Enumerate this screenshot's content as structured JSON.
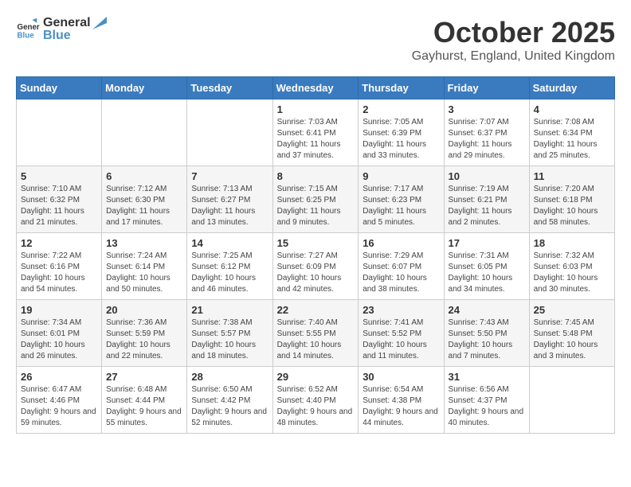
{
  "header": {
    "logo_general": "General",
    "logo_blue": "Blue",
    "month": "October 2025",
    "location": "Gayhurst, England, United Kingdom"
  },
  "days_of_week": [
    "Sunday",
    "Monday",
    "Tuesday",
    "Wednesday",
    "Thursday",
    "Friday",
    "Saturday"
  ],
  "weeks": [
    [
      {
        "day": "",
        "info": ""
      },
      {
        "day": "",
        "info": ""
      },
      {
        "day": "",
        "info": ""
      },
      {
        "day": "1",
        "info": "Sunrise: 7:03 AM\nSunset: 6:41 PM\nDaylight: 11 hours and 37 minutes."
      },
      {
        "day": "2",
        "info": "Sunrise: 7:05 AM\nSunset: 6:39 PM\nDaylight: 11 hours and 33 minutes."
      },
      {
        "day": "3",
        "info": "Sunrise: 7:07 AM\nSunset: 6:37 PM\nDaylight: 11 hours and 29 minutes."
      },
      {
        "day": "4",
        "info": "Sunrise: 7:08 AM\nSunset: 6:34 PM\nDaylight: 11 hours and 25 minutes."
      }
    ],
    [
      {
        "day": "5",
        "info": "Sunrise: 7:10 AM\nSunset: 6:32 PM\nDaylight: 11 hours and 21 minutes."
      },
      {
        "day": "6",
        "info": "Sunrise: 7:12 AM\nSunset: 6:30 PM\nDaylight: 11 hours and 17 minutes."
      },
      {
        "day": "7",
        "info": "Sunrise: 7:13 AM\nSunset: 6:27 PM\nDaylight: 11 hours and 13 minutes."
      },
      {
        "day": "8",
        "info": "Sunrise: 7:15 AM\nSunset: 6:25 PM\nDaylight: 11 hours and 9 minutes."
      },
      {
        "day": "9",
        "info": "Sunrise: 7:17 AM\nSunset: 6:23 PM\nDaylight: 11 hours and 5 minutes."
      },
      {
        "day": "10",
        "info": "Sunrise: 7:19 AM\nSunset: 6:21 PM\nDaylight: 11 hours and 2 minutes."
      },
      {
        "day": "11",
        "info": "Sunrise: 7:20 AM\nSunset: 6:18 PM\nDaylight: 10 hours and 58 minutes."
      }
    ],
    [
      {
        "day": "12",
        "info": "Sunrise: 7:22 AM\nSunset: 6:16 PM\nDaylight: 10 hours and 54 minutes."
      },
      {
        "day": "13",
        "info": "Sunrise: 7:24 AM\nSunset: 6:14 PM\nDaylight: 10 hours and 50 minutes."
      },
      {
        "day": "14",
        "info": "Sunrise: 7:25 AM\nSunset: 6:12 PM\nDaylight: 10 hours and 46 minutes."
      },
      {
        "day": "15",
        "info": "Sunrise: 7:27 AM\nSunset: 6:09 PM\nDaylight: 10 hours and 42 minutes."
      },
      {
        "day": "16",
        "info": "Sunrise: 7:29 AM\nSunset: 6:07 PM\nDaylight: 10 hours and 38 minutes."
      },
      {
        "day": "17",
        "info": "Sunrise: 7:31 AM\nSunset: 6:05 PM\nDaylight: 10 hours and 34 minutes."
      },
      {
        "day": "18",
        "info": "Sunrise: 7:32 AM\nSunset: 6:03 PM\nDaylight: 10 hours and 30 minutes."
      }
    ],
    [
      {
        "day": "19",
        "info": "Sunrise: 7:34 AM\nSunset: 6:01 PM\nDaylight: 10 hours and 26 minutes."
      },
      {
        "day": "20",
        "info": "Sunrise: 7:36 AM\nSunset: 5:59 PM\nDaylight: 10 hours and 22 minutes."
      },
      {
        "day": "21",
        "info": "Sunrise: 7:38 AM\nSunset: 5:57 PM\nDaylight: 10 hours and 18 minutes."
      },
      {
        "day": "22",
        "info": "Sunrise: 7:40 AM\nSunset: 5:55 PM\nDaylight: 10 hours and 14 minutes."
      },
      {
        "day": "23",
        "info": "Sunrise: 7:41 AM\nSunset: 5:52 PM\nDaylight: 10 hours and 11 minutes."
      },
      {
        "day": "24",
        "info": "Sunrise: 7:43 AM\nSunset: 5:50 PM\nDaylight: 10 hours and 7 minutes."
      },
      {
        "day": "25",
        "info": "Sunrise: 7:45 AM\nSunset: 5:48 PM\nDaylight: 10 hours and 3 minutes."
      }
    ],
    [
      {
        "day": "26",
        "info": "Sunrise: 6:47 AM\nSunset: 4:46 PM\nDaylight: 9 hours and 59 minutes."
      },
      {
        "day": "27",
        "info": "Sunrise: 6:48 AM\nSunset: 4:44 PM\nDaylight: 9 hours and 55 minutes."
      },
      {
        "day": "28",
        "info": "Sunrise: 6:50 AM\nSunset: 4:42 PM\nDaylight: 9 hours and 52 minutes."
      },
      {
        "day": "29",
        "info": "Sunrise: 6:52 AM\nSunset: 4:40 PM\nDaylight: 9 hours and 48 minutes."
      },
      {
        "day": "30",
        "info": "Sunrise: 6:54 AM\nSunset: 4:38 PM\nDaylight: 9 hours and 44 minutes."
      },
      {
        "day": "31",
        "info": "Sunrise: 6:56 AM\nSunset: 4:37 PM\nDaylight: 9 hours and 40 minutes."
      },
      {
        "day": "",
        "info": ""
      }
    ]
  ]
}
